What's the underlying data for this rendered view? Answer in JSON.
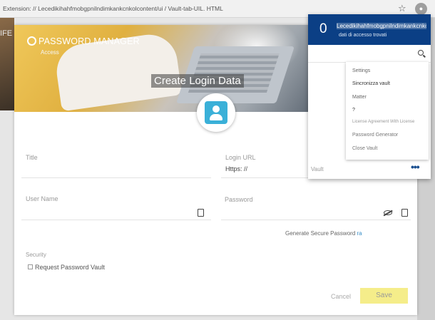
{
  "browser": {
    "url": "Extension: // Lecedikihahfmobgpnilndimkankcnkolcontent/ui / Vault-tab-UIL. HTML",
    "star_icon": "star-icon",
    "extension_icon": "extension-icon"
  },
  "background": {
    "side_text": "IFE"
  },
  "modal": {
    "brand": "PASSWORD MANAGER",
    "access": "Access",
    "title": "Create Login Data",
    "fields": {
      "title_label": "Title",
      "login_url_label": "Login URL",
      "login_url_value": "Https: //",
      "username_label": "User Name",
      "password_label": "Password"
    },
    "generate_label": "Generate Secure Password",
    "generate_suffix": "ra",
    "security_label": "Security",
    "request_label": "Request Password Vault",
    "cancel_label": "Cancel",
    "save_label": "Save"
  },
  "popup": {
    "count": "0",
    "site": "Lecedikihahfmobgpnilndimkankcnkol",
    "found": "dati di accesso trovati",
    "vault_label": "Vault",
    "menu": [
      "Settings",
      "Sincronizza vault",
      "Matter",
      "?",
      "License Agreement With License",
      "Password Generator",
      "Close Vault"
    ]
  },
  "colors": {
    "popup_header": "#0b3f85",
    "accent_icon": "#3ab0d8",
    "save_button": "#f5ed8a"
  }
}
